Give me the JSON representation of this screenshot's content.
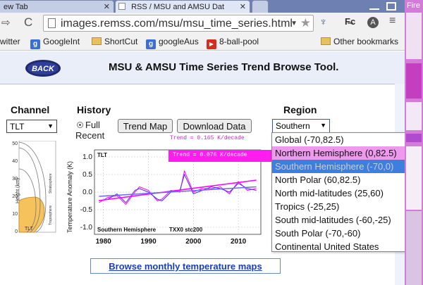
{
  "browser": {
    "tabs": [
      {
        "label": "ew Tab",
        "active": false
      },
      {
        "label": "RSS / MSU and AMSU Dat",
        "active": true
      },
      {
        "label": "",
        "active": false
      }
    ],
    "address_bar": {
      "url": "images.remss.com/msu/msu_time_series.html"
    },
    "bookmarks": [
      {
        "label": "witter",
        "icon": "none"
      },
      {
        "label": "GoogleInt",
        "icon": "google-icon"
      },
      {
        "label": "ShortCut",
        "icon": "folder-icon"
      },
      {
        "label": "googleAus",
        "icon": "google-icon"
      },
      {
        "label": "8-ball-pool",
        "icon": "youtube-icon"
      },
      {
        "label": "Other bookmarks",
        "icon": "folder-icon"
      }
    ]
  },
  "page": {
    "back_label": "BACK",
    "title": "MSU & AMSU Time Series Trend Browse Tool.",
    "channel": {
      "label": "Channel",
      "selected": "TLT"
    },
    "history": {
      "label": "History",
      "options": [
        "Full",
        "Recent"
      ],
      "selected": "Full"
    },
    "buttons": {
      "trend_map": "Trend Map",
      "download": "Download Data"
    },
    "region": {
      "label": "Region",
      "selected": "Southern",
      "options": [
        "Global (-70,82.5)",
        "Northern Hemisphere (0,82.5)",
        "Southern Hemisphere (-70,0)",
        "North Polar (60,82.5)",
        "North mid-latitudes (25,60)",
        "Tropics (-25,25)",
        "South mid-latitudes (-60,-25)",
        "South Polar (-70,-60)",
        "Continental United States"
      ],
      "hovered_index": 1,
      "highlighted_index": 2
    },
    "height_panel": {
      "ylabel": "Height (km)",
      "ticks": [
        "50",
        "40",
        "30",
        "20",
        "10",
        "0"
      ],
      "layer_labels": [
        "Stratosphere",
        "Troposphere"
      ],
      "channel_tag": "TLT"
    },
    "trends": {
      "line1": "Trend = 0.165 K/decade",
      "line2": "Trend = 0.076 K/decade"
    },
    "browse_link": "Browse monthly temperature maps"
  },
  "chart_data": {
    "type": "line",
    "channel_tag": "TLT",
    "region_label": "Southern Hemisphere",
    "overlay_text": "TXX0 stc200",
    "ylabel": "Temperature Anomaly (K)",
    "ylim": [
      -1.2,
      1.2
    ],
    "xlim": [
      1978,
      2015
    ],
    "yticks": [
      "1.0",
      "0.5",
      "0.0",
      "-0.5",
      "-1.0"
    ],
    "xticks": [
      "1980",
      "1990",
      "2000",
      "2010"
    ],
    "series": [
      {
        "name": "",
        "color": "#ff00ff",
        "style": "monthly_a",
        "x": [
          1979,
          1981,
          1983,
          1985,
          1987,
          1988,
          1990,
          1992,
          1993,
          1995,
          1997,
          1998,
          2000,
          2002,
          2004,
          2006,
          2008,
          2010,
          2012,
          2014
        ],
        "y": [
          -0.3,
          -0.15,
          -0.1,
          -0.35,
          0.0,
          0.15,
          0.05,
          -0.25,
          -0.2,
          0.05,
          0.0,
          0.6,
          0.0,
          0.1,
          0.1,
          0.15,
          -0.05,
          0.3,
          0.05,
          0.1
        ]
      },
      {
        "name": "",
        "color": "#4a2aff",
        "style": "monthly_b",
        "x": [
          1979,
          1981,
          1983,
          1985,
          1987,
          1988,
          1990,
          1992,
          1993,
          1995,
          1997,
          1998,
          2000,
          2002,
          2004,
          2006,
          2008,
          2010,
          2012,
          2014
        ],
        "y": [
          -0.25,
          -0.2,
          -0.05,
          -0.3,
          0.05,
          0.1,
          0.0,
          -0.2,
          -0.25,
          0.0,
          0.05,
          0.5,
          -0.05,
          0.05,
          0.15,
          0.1,
          0.0,
          0.25,
          0.1,
          0.05
        ]
      },
      {
        "name": "",
        "color": "#ff00ff",
        "style": "trend",
        "x": [
          1979,
          2014
        ],
        "y": [
          -0.24,
          0.34
        ]
      },
      {
        "name": "",
        "color": "#6a6aff",
        "style": "trend",
        "x": [
          1979,
          2014
        ],
        "y": [
          -0.12,
          0.15
        ]
      }
    ]
  },
  "side_window": {
    "title": "Fire"
  }
}
